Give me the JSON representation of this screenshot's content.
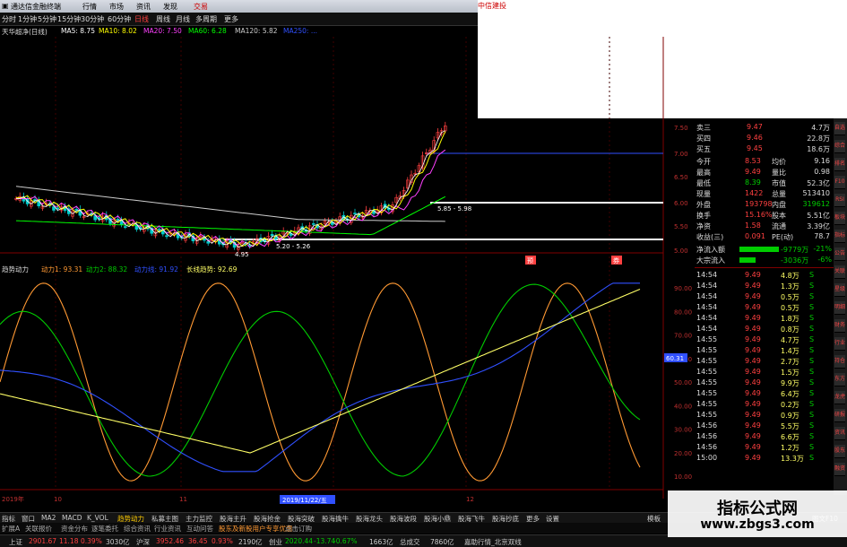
{
  "titlebar": {
    "app_title": "通达信金融终端",
    "menu": [
      "行情",
      "市场",
      "资讯",
      "发现",
      "交易"
    ],
    "broker": "中信建投"
  },
  "toolbar": {
    "periods": [
      "分时",
      "1分钟",
      "5分钟",
      "15分钟",
      "30分钟",
      "60分钟",
      "日线",
      "周线",
      "月线",
      "多周期",
      "更多"
    ],
    "active_period": "日线"
  },
  "ma_bar": {
    "stock": "天华超净(日线)",
    "items": [
      {
        "label": "MA5: 8.75",
        "color": "#ffffff"
      },
      {
        "label": "MA10: 8.02",
        "color": "#ffff00"
      },
      {
        "label": "MA20: 7.50",
        "color": "#ff40ff"
      },
      {
        "label": "MA60: 6.28",
        "color": "#00ff00"
      },
      {
        "label": "MA120: 5.82",
        "color": "#cccccc"
      },
      {
        "label": "MA250: ...",
        "color": "#3050ff"
      }
    ]
  },
  "price_axis": [
    "7.50",
    "7.00",
    "6.50",
    "6.00",
    "5.50",
    "5.00"
  ],
  "price_annotations": {
    "low": "4.95",
    "range1": "5.20 - 5.26",
    "range2": "5.85 - 5.98"
  },
  "markers": [
    "预",
    "券"
  ],
  "indicator_bar": {
    "name": "趋势动力",
    "items": [
      {
        "label": "动力1: 93.31",
        "color": "#ff9933"
      },
      {
        "label": "动力2: 88.32",
        "color": "#00cc00"
      },
      {
        "label": "动力线: 91.92",
        "color": "#3050ff"
      },
      {
        "label": "长线趋势: 92.69",
        "color": "#ffff66"
      }
    ]
  },
  "indicator_axis": [
    "90.00",
    "80.00",
    "70.00",
    "60.00",
    "50.00",
    "40.00",
    "30.00",
    "20.00",
    "10.00"
  ],
  "indicator_value_tag": "60.31",
  "date_axis": {
    "left": "2019年",
    "month1": "10",
    "month2": "11",
    "date_tag": "2019/11/22/五",
    "month3": "12"
  },
  "quote_panel": {
    "asks": [
      {
        "label": "卖三",
        "price": "9.47",
        "vol": "4.7万"
      },
      {
        "label": "买四",
        "price": "9.46",
        "vol": "22.8万"
      },
      {
        "label": "买五",
        "price": "9.45",
        "vol": "18.6万"
      }
    ],
    "stats": [
      {
        "l1": "今开",
        "v1": "8.53",
        "l2": "均价",
        "v2": "9.16"
      },
      {
        "l1": "最高",
        "v1": "9.49",
        "l2": "量比",
        "v2": "0.98"
      },
      {
        "l1": "最低",
        "v1": "8.39",
        "l2": "市值",
        "v2": "52.3亿"
      },
      {
        "l1": "现量",
        "v1": "1422",
        "l2": "总量",
        "v2": "513410"
      },
      {
        "l1": "外盘",
        "v1": "193798",
        "l2": "内盘",
        "v2": "319612"
      },
      {
        "l1": "换手",
        "v1": "15.16%",
        "l2": "股本",
        "v2": "5.51亿"
      },
      {
        "l1": "净资",
        "v1": "1.58",
        "l2": "流通",
        "v2": "3.39亿"
      },
      {
        "l1": "收益(三)",
        "v1": "0.091",
        "l2": "PE(动)",
        "v2": "78.7"
      }
    ],
    "flows": [
      {
        "label": "净流入额",
        "value": "-9779万",
        "pct": "-21%"
      },
      {
        "label": "大宗流入",
        "value": "-3036万",
        "pct": "-6%"
      }
    ],
    "ticks": [
      {
        "time": "14:54",
        "price": "9.49",
        "vol": "4.8万",
        "side": "S"
      },
      {
        "time": "14:54",
        "price": "9.49",
        "vol": "1.3万",
        "side": "S"
      },
      {
        "time": "14:54",
        "price": "9.49",
        "vol": "0.5万",
        "side": "S"
      },
      {
        "time": "14:54",
        "price": "9.49",
        "vol": "0.5万",
        "side": "S"
      },
      {
        "time": "14:54",
        "price": "9.49",
        "vol": "1.8万",
        "side": "S"
      },
      {
        "time": "14:54",
        "price": "9.49",
        "vol": "0.8万",
        "side": "S"
      },
      {
        "time": "14:55",
        "price": "9.49",
        "vol": "4.7万",
        "side": "S"
      },
      {
        "time": "14:55",
        "price": "9.49",
        "vol": "1.4万",
        "side": "S"
      },
      {
        "time": "14:55",
        "price": "9.49",
        "vol": "2.7万",
        "side": "S"
      },
      {
        "time": "14:55",
        "price": "9.49",
        "vol": "1.5万",
        "side": "S"
      },
      {
        "time": "14:55",
        "price": "9.49",
        "vol": "9.9万",
        "side": "S"
      },
      {
        "time": "14:55",
        "price": "9.49",
        "vol": "6.4万",
        "side": "S"
      },
      {
        "time": "14:55",
        "price": "9.49",
        "vol": "0.2万",
        "side": "S"
      },
      {
        "time": "14:55",
        "price": "9.49",
        "vol": "0.9万",
        "side": "S"
      },
      {
        "time": "14:56",
        "price": "9.49",
        "vol": "5.5万",
        "side": "S"
      },
      {
        "time": "14:56",
        "price": "9.49",
        "vol": "6.6万",
        "side": "S"
      },
      {
        "time": "14:56",
        "price": "9.49",
        "vol": "1.2万",
        "side": "S"
      },
      {
        "time": "15:00",
        "price": "9.49",
        "vol": "13.3万",
        "side": "S"
      }
    ]
  },
  "right_tabs": [
    "自选",
    "综合",
    "排名",
    "F10",
    "RSI",
    "板块",
    "指标",
    "公告",
    "关联",
    "星级",
    "明细",
    "财务",
    "行业",
    "持仓",
    "东方",
    "龙虎",
    "研报",
    "资讯",
    "股东",
    "融资"
  ],
  "bottom_tabs": [
    "指标",
    "窗口",
    "MA2",
    "MACD",
    "K_VOL",
    "趋势动力",
    "私募主图",
    "主力监控",
    "股海主升",
    "股海抢金",
    "股海突破",
    "股海擒牛",
    "股海龙头",
    "股海波段",
    "股海小鼎",
    "股海飞牛",
    "股海抄底",
    "更多",
    "设置"
  ],
  "bottom_tabs_active": "趋势动力",
  "bottom_right": {
    "label1": "模板",
    "label2": "图文F10"
  },
  "status_bar": [
    "扩展A",
    "关联报价",
    "资金分布",
    "逐笔委托",
    "综合资讯",
    "行业资讯",
    "互动问答",
    "股东及新股用户专享优惠",
    "点击订购"
  ],
  "ticker": [
    {
      "text": "上证",
      "color": "#cccccc"
    },
    {
      "text": "2901.67",
      "color": "#ff4040"
    },
    {
      "text": "11.18",
      "color": "#ff4040"
    },
    {
      "text": "0.39%",
      "color": "#ff4040"
    },
    {
      "text": "3030亿",
      "color": "#cccccc"
    },
    {
      "text": "沪深",
      "color": "#cccccc"
    },
    {
      "text": "3952.46",
      "color": "#ff4040"
    },
    {
      "text": "36.45",
      "color": "#ff4040"
    },
    {
      "text": "0.93%",
      "color": "#ff4040"
    },
    {
      "text": "2190亿",
      "color": "#cccccc"
    },
    {
      "text": "创业",
      "color": "#cccccc"
    },
    {
      "text": "2020.44",
      "color": "#00cc00"
    },
    {
      "text": "-13.74",
      "color": "#00cc00"
    },
    {
      "text": "-0.67%",
      "color": "#00cc00"
    },
    {
      "text": "1663亿",
      "color": "#cccccc"
    },
    {
      "text": "总成交",
      "color": "#cccccc"
    },
    {
      "text": "7860亿",
      "color": "#cccccc"
    },
    {
      "text": "嘉助行情_北京双线",
      "color": "#cccccc"
    }
  ],
  "watermark": {
    "title": "指标公式网",
    "url": "www.zbgs3.com"
  },
  "colors": {
    "up": "#ff4040",
    "down": "#00cccc",
    "ma5": "#ffffff",
    "ma10": "#ffff00",
    "ma20": "#ff40ff",
    "ma60": "#00ff00",
    "ma120": "#cccccc",
    "ma250": "#3050ff",
    "dongli1": "#ff9933",
    "dongli2": "#00cc00",
    "dongli_line": "#3050ff",
    "long_trend": "#ffff66"
  }
}
